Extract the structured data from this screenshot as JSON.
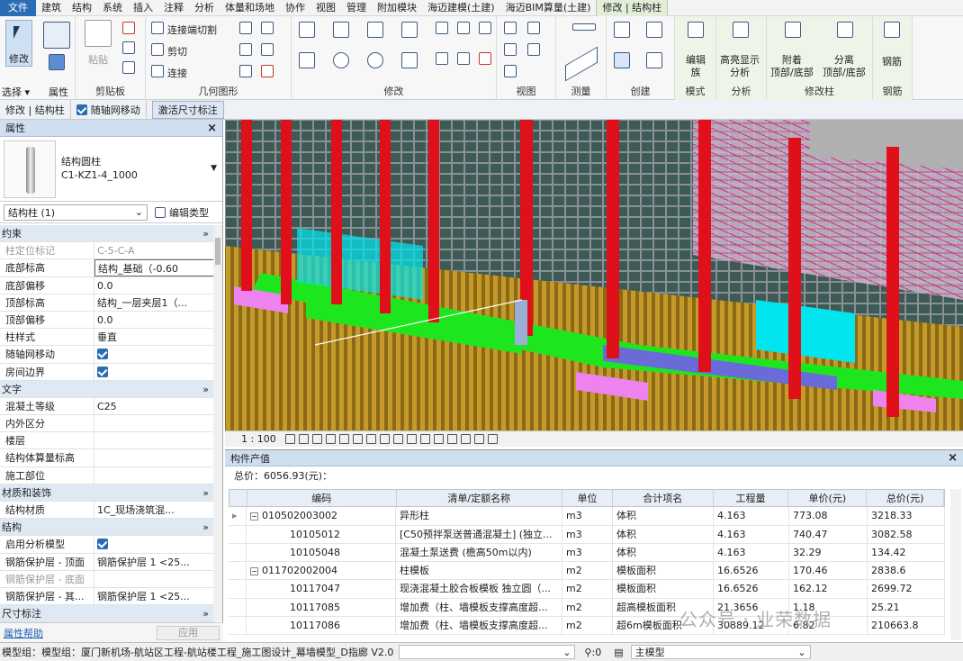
{
  "menu": [
    "文件",
    "建筑",
    "结构",
    "系统",
    "插入",
    "注释",
    "分析",
    "体量和场地",
    "协作",
    "视图",
    "管理",
    "附加模块",
    "海迈建模(土建)",
    "海迈BIM算量(土建)",
    "修改 | 结构柱"
  ],
  "ribbon": {
    "modify_label": "修改",
    "select_label": "选择 ▾",
    "props_label": "属性",
    "paste_label": "粘贴",
    "clipboard_label": "剪贴板",
    "geom_join_cut": "连接端切割",
    "geom_cut": "剪切",
    "geom_join": "连接",
    "geometry_label": "几何图形",
    "modify_group_label": "修改",
    "view_label": "视图",
    "measure_label": "测量",
    "create_label": "创建",
    "edit_family": "编辑\n族",
    "mode_label": "模式",
    "highlight": "高亮显示\n分析",
    "analysis_label": "分析",
    "attach": "附着\n顶部/底部",
    "detach": "分离\n顶部/底部",
    "modcol_label": "修改柱",
    "rebar": "钢筋",
    "rebar_label": "钢筋"
  },
  "options": {
    "context": "修改 | 结构柱",
    "move_with_grid": "随轴网移动",
    "activate_dim": "激活尺寸标注"
  },
  "properties": {
    "title": "属性",
    "close": "×",
    "type_line1": "结构圆柱",
    "type_line2": "C1-KZ1-4_1000",
    "category": "结构柱 (1)",
    "edit_type": "编辑类型",
    "help": "属性帮助",
    "apply": "应用",
    "rows": [
      {
        "k": "约束",
        "v": "»",
        "sec": true
      },
      {
        "k": "柱定位标记",
        "v": "C-5-C-A",
        "dis": true
      },
      {
        "k": "底部标高",
        "v": "结构_基础（-0.60",
        "box": true
      },
      {
        "k": "底部偏移",
        "v": "0.0"
      },
      {
        "k": "顶部标高",
        "v": "结构_一层夹层1（..."
      },
      {
        "k": "顶部偏移",
        "v": "0.0"
      },
      {
        "k": "柱样式",
        "v": "垂直"
      },
      {
        "k": "随轴网移动",
        "v": "",
        "chk": true
      },
      {
        "k": "房间边界",
        "v": "",
        "chk": true
      },
      {
        "k": "文字",
        "v": "»",
        "sec": true
      },
      {
        "k": "混凝土等级",
        "v": "C25"
      },
      {
        "k": "内外区分",
        "v": ""
      },
      {
        "k": "楼层",
        "v": ""
      },
      {
        "k": "结构体算量标高",
        "v": ""
      },
      {
        "k": "施工部位",
        "v": ""
      },
      {
        "k": "材质和装饰",
        "v": "»",
        "sec": true
      },
      {
        "k": "结构材质",
        "v": "1C_现场浇筑混..."
      },
      {
        "k": "结构",
        "v": "»",
        "sec": true
      },
      {
        "k": "启用分析模型",
        "v": "",
        "chk": true
      },
      {
        "k": "钢筋保护层 - 顶面",
        "v": "钢筋保护层 1 <25..."
      },
      {
        "k": "钢筋保护层 - 底面",
        "v": "",
        "dis": true
      },
      {
        "k": "钢筋保护层 - 其...",
        "v": "钢筋保护层 1 <25..."
      },
      {
        "k": "尺寸标注",
        "v": "»",
        "sec": true
      }
    ]
  },
  "viewbar": {
    "scale": "1 : 100"
  },
  "cost": {
    "title": "构件产值",
    "close": "×",
    "total": "总价：6056.93(元)：",
    "headers": [
      "",
      "编码",
      "清单/定额名称",
      "单位",
      "合计项名",
      "工程量",
      "单价(元)",
      "总价(元)"
    ],
    "rows": [
      {
        "lvl": 0,
        "code": "010502003002",
        "name": "异形柱",
        "unit": "m3",
        "item": "体积",
        "qty": "4.163",
        "price": "773.08",
        "total": "3218.33"
      },
      {
        "lvl": 1,
        "code": "10105012",
        "name": "[C50预拌泵送普通混凝土] (独立...",
        "unit": "m3",
        "item": "体积",
        "qty": "4.163",
        "price": "740.47",
        "total": "3082.58"
      },
      {
        "lvl": 1,
        "code": "10105048",
        "name": "混凝土泵送费 (檐高50m以内)",
        "unit": "m3",
        "item": "体积",
        "qty": "4.163",
        "price": "32.29",
        "total": "134.42"
      },
      {
        "lvl": 0,
        "code": "011702002004",
        "name": "柱模板",
        "unit": "m2",
        "item": "模板面积",
        "qty": "16.6526",
        "price": "170.46",
        "total": "2838.6"
      },
      {
        "lvl": 1,
        "code": "10117047",
        "name": "现浇混凝土胶合板模板 独立圆（...",
        "unit": "m2",
        "item": "模板面积",
        "qty": "16.6526",
        "price": "162.12",
        "total": "2699.72"
      },
      {
        "lvl": 1,
        "code": "10117085",
        "name": "增加费（柱、墙模板支撑高度超...",
        "unit": "m2",
        "item": "超高模板面积",
        "qty": "21.3656",
        "price": "1.18",
        "total": "25.21"
      },
      {
        "lvl": 1,
        "code": "10117086",
        "name": "增加费（柱、墙模板支撑高度超...",
        "unit": "m2",
        "item": "超6m模板面积",
        "qty": "30889.12",
        "price": "6.82",
        "total": "210663.8"
      }
    ]
  },
  "watermark": "公众号 · 业荣数据",
  "status": {
    "text": "模型组：模型组：厦门新机场-航站区工程-航站楼工程_施工图设计_幕墙模型_D指廊 V2.0",
    "zero": ":0",
    "model": "主模型"
  }
}
